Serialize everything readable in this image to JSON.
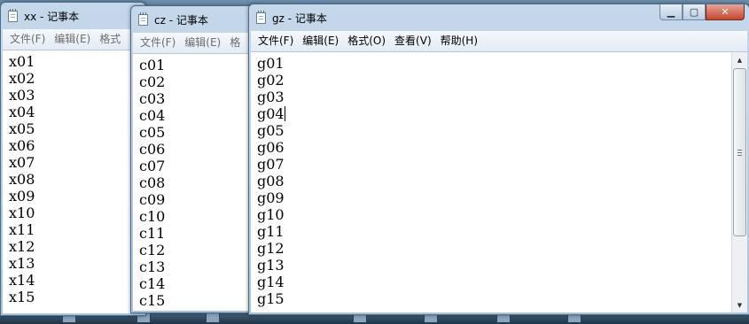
{
  "windows": {
    "xx": {
      "title": "xx - 记事本",
      "menu": [
        "文件(F)",
        "编辑(E)",
        "格式"
      ],
      "lines": [
        "x01",
        "x02",
        "x03",
        "x04",
        "x05",
        "x06",
        "x07",
        "x08",
        "x09",
        "x10",
        "x11",
        "x12",
        "x13",
        "x14",
        "x15"
      ]
    },
    "cz": {
      "title": "cz - 记事本",
      "menu": [
        "文件(F)",
        "编辑(E)",
        "格"
      ],
      "lines": [
        "c01",
        "c02",
        "c03",
        "c04",
        "c05",
        "c06",
        "c07",
        "c08",
        "c09",
        "c10",
        "c11",
        "c12",
        "c13",
        "c14",
        "c15"
      ]
    },
    "gz": {
      "title": "gz - 记事本",
      "menu": [
        "文件(F)",
        "编辑(E)",
        "格式(O)",
        "查看(V)",
        "帮助(H)"
      ],
      "lines": [
        "g01",
        "g02",
        "g03",
        "g04",
        "g05",
        "g06",
        "g07",
        "g08",
        "g09",
        "g10",
        "g11",
        "g12",
        "g13",
        "g14",
        "g15"
      ],
      "caret_line": 3
    }
  },
  "icons": {
    "app": "notepad-icon",
    "minimize": "minimize-icon",
    "maximize": "maximize-icon",
    "close": "close-icon",
    "scroll_up": "scroll-up-arrow-icon",
    "scroll_down": "scroll-down-arrow-icon"
  },
  "colors": {
    "desktop": "#6b8fae",
    "window_frame": "#b8cee4",
    "close_button": "#c6452d",
    "editor_background": "#ffffff"
  },
  "glyphs": {
    "minimize": "▁",
    "maximize": "▢",
    "close": "✕",
    "scroll_up": "▲",
    "scroll_down": "▼"
  }
}
